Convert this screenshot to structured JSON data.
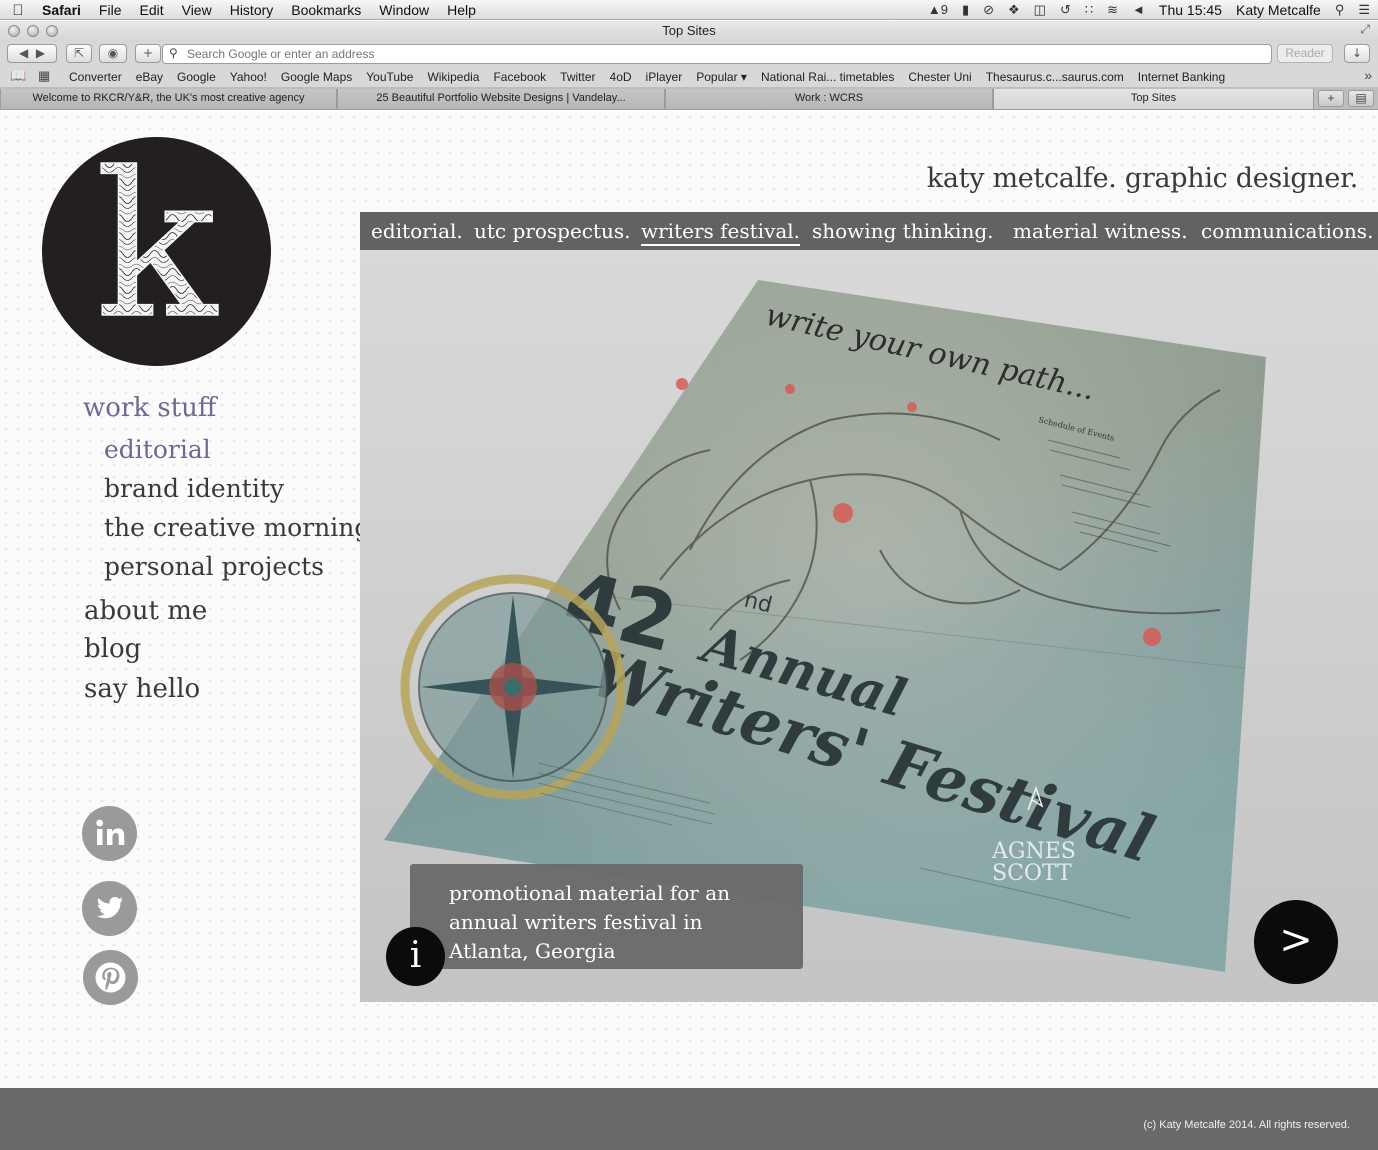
{
  "menubar": {
    "apple_icon": "apple-logo-icon",
    "app_name": "Safari",
    "items": [
      "File",
      "Edit",
      "View",
      "History",
      "Bookmarks",
      "Window",
      "Help"
    ],
    "status": {
      "adobe_updates": "9",
      "clock": "Thu 15:45",
      "user": "Katy Metcalfe"
    }
  },
  "window": {
    "title": "Top Sites"
  },
  "toolbar": {
    "address_placeholder": "Search Google or enter an address",
    "reader_label": "Reader"
  },
  "bookmarks": [
    "Converter",
    "eBay",
    "Google",
    "Yahoo!",
    "Google Maps",
    "YouTube",
    "Wikipedia",
    "Facebook",
    "Twitter",
    "4oD",
    "iPlayer",
    "Popular ▾",
    "National Rai... timetables",
    "Chester Uni",
    "Thesaurus.c...saurus.com",
    "Internet Banking"
  ],
  "tabs": [
    {
      "label": "Welcome to RKCR/Y&R, the UK's most creative agency",
      "active": false
    },
    {
      "label": "25 Beautiful Portfolio Website Designs | Vandelay...",
      "active": false
    },
    {
      "label": "Work : WCRS",
      "active": false
    },
    {
      "label": "Top Sites",
      "active": true
    }
  ],
  "site": {
    "logo_letter": "k",
    "title": "katy metcalfe. graphic designer.",
    "nav": {
      "work_stuff": "work stuff",
      "editorial": "editorial",
      "brand_identity": "brand identity",
      "creative_mornings": "the creative mornings",
      "personal_projects": "personal projects",
      "about_me": "about me",
      "blog": "blog",
      "say_hello": "say hello"
    },
    "social": [
      "linkedin-icon",
      "twitter-icon",
      "pinterest-icon"
    ],
    "project_tabs": [
      "editorial.",
      "utc prospectus.",
      "writers festival.",
      "showing thinking.",
      "material witness.",
      "communications."
    ],
    "active_project_tab": "writers festival.",
    "caption": "promotional material for an annual writers festival in Atlanta, Georgia",
    "info_label": "i",
    "next_label": ">",
    "poster": {
      "headline": "write your own path...",
      "number": "42",
      "ordinal": "nd",
      "title_line1": "Annual",
      "title_line2": "Writers' Festival",
      "schedule_title": "Schedule of Events",
      "college_line1": "AGNES",
      "college_line2": "SCOTT"
    },
    "footer": "(c) Katy Metcalfe 2014. All rights reserved."
  }
}
